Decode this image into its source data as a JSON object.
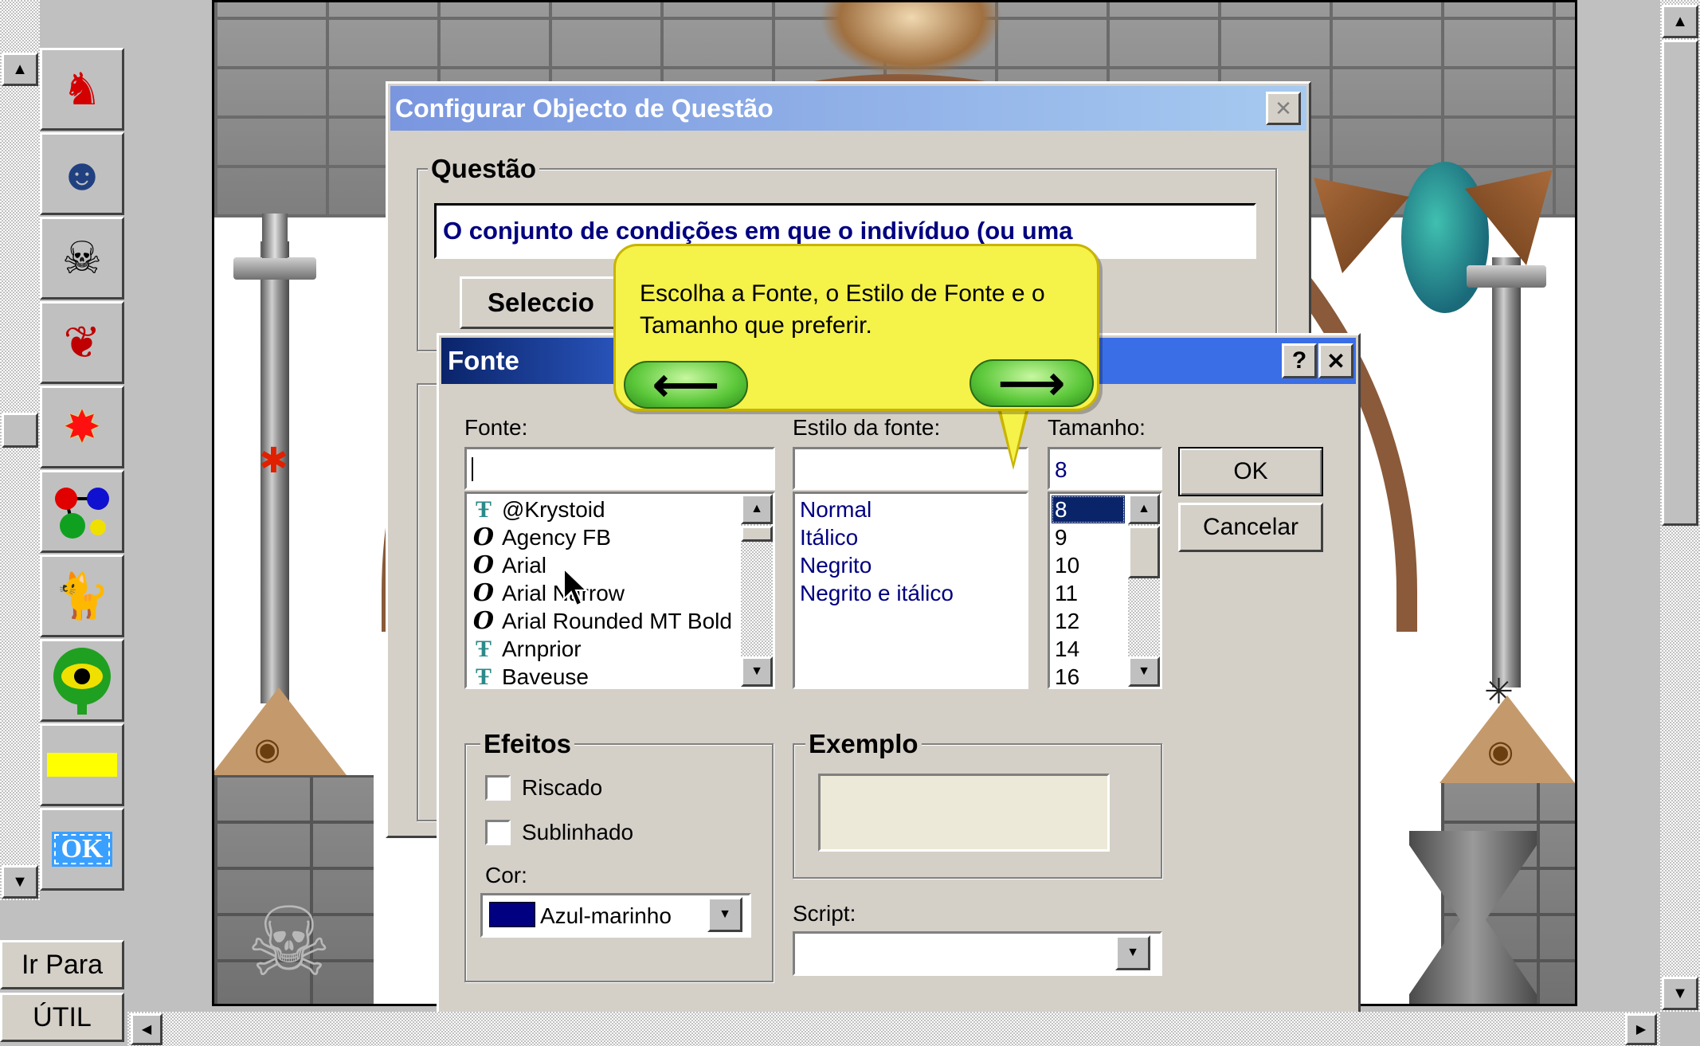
{
  "left_panel": {
    "tools": [
      {
        "name": "knight-tool",
        "glyph": "🗡"
      },
      {
        "name": "bandit-tool",
        "glyph": "🏍"
      },
      {
        "name": "skull-tool",
        "glyph": "☠"
      },
      {
        "name": "bird-tool",
        "glyph": "🐦"
      },
      {
        "name": "explosion-tool",
        "glyph": "✸"
      },
      {
        "name": "molecule-tool",
        "glyph": "⚛"
      },
      {
        "name": "cat-tool",
        "glyph": "🐈"
      },
      {
        "name": "eye-tool",
        "glyph": "👁"
      },
      {
        "name": "yellow-bar-tool",
        "glyph": ""
      },
      {
        "name": "ok-tool",
        "glyph": "OK"
      }
    ],
    "go_to_label": "Ir Para",
    "util_label": "ÚTIL"
  },
  "config_dialog": {
    "title": "Configurar Objecto de Questão",
    "close_label": "✕",
    "question_group": "Questão",
    "question_text": "O conjunto de condições em que o indivíduo (ou uma",
    "select_button": "Seleccio"
  },
  "tooltip": {
    "text": "Escolha a Fonte, o Estilo de Fonte e o Tamanho que preferir.",
    "back_arrow": "⟵",
    "next_arrow": "⟶"
  },
  "font_dialog": {
    "title": "Fonte",
    "help_label": "?",
    "close_label": "✕",
    "font_label": "Fonte:",
    "font_value": "",
    "style_label": "Estilo da fonte:",
    "style_value": "",
    "size_label": "Tamanho:",
    "size_value": "8",
    "ok_label": "OK",
    "cancel_label": "Cancelar",
    "fonts": [
      {
        "name": "@Krystoid",
        "type": "truetype"
      },
      {
        "name": "Agency FB",
        "type": "opentype"
      },
      {
        "name": "Arial",
        "type": "opentype"
      },
      {
        "name": "Arial Narrow",
        "type": "opentype"
      },
      {
        "name": "Arial Rounded MT Bold",
        "type": "opentype"
      },
      {
        "name": "Arnprior",
        "type": "truetype"
      },
      {
        "name": "Baveuse",
        "type": "truetype"
      }
    ],
    "styles": [
      "Normal",
      "Itálico",
      "Negrito",
      "Negrito e itálico"
    ],
    "sizes": [
      "8",
      "9",
      "10",
      "11",
      "12",
      "14",
      "16"
    ],
    "selected_size": "8",
    "effects_group": "Efeitos",
    "strike_label": "Riscado",
    "underline_label": "Sublinhado",
    "color_label": "Cor:",
    "color_value": "Azul-marinho",
    "color_swatch": "#000080",
    "example_group": "Exemplo",
    "script_label": "Script:",
    "script_value": ""
  },
  "colors": {
    "accent": "#0a246a",
    "text_navy": "#000080",
    "dialog_bg": "#d4d0c8"
  }
}
